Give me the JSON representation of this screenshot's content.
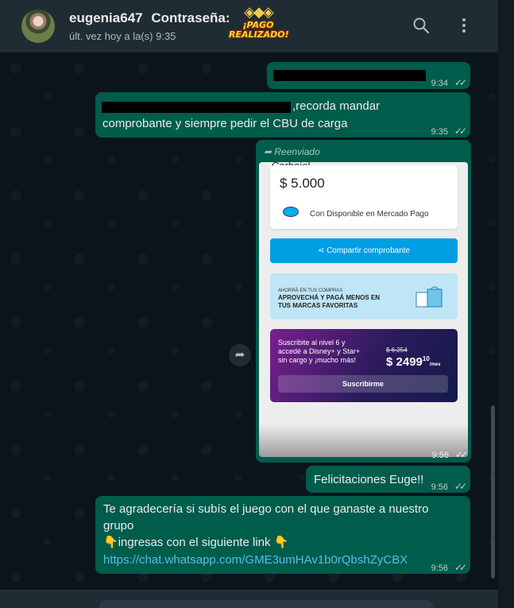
{
  "header": {
    "contact_name": "eugenia647",
    "contact_extra": "Contraseña:",
    "last_seen": "últ. vez hoy a la(s) 9:35",
    "sticker_line1": "¡PAGO",
    "sticker_line2": "REALIZADO!"
  },
  "messages": [
    {
      "time": "9:34",
      "ticks": "✓✓"
    },
    {
      "text_visible": ",recorda mandar",
      "text_line2": "comprobante y siempre pedir el CBU de carga",
      "time": "9:35",
      "ticks": "✓✓"
    },
    {
      "forwarded_label": "Reenviado",
      "time": "9:56",
      "ticks": "✓✓",
      "screenshot": {
        "partial_name": "Carbajal",
        "amount": "$ 5.000",
        "payment_method": "Con Disponible en Mercado Pago",
        "share_button": "Compartir comprobante",
        "promo_small": "AHORRÁ EN TUS COMPRAS",
        "promo_line1": "APROVECHÁ Y PAGÁ MENOS EN",
        "promo_line2": "TUS MARCAS FAVORITAS",
        "subscribe_line1": "Suscribite al nivel 6 y",
        "subscribe_line2": "accedé a Disney+ y Star+",
        "subscribe_line3": "sin cargo y ¡mucho más!",
        "old_price": "$ 6.254",
        "new_price": "$ 2499",
        "new_price_cents": "10",
        "per_month": "/mes",
        "subscribe_button": "Suscribirme"
      }
    },
    {
      "text": "Felicitaciones Euge!!",
      "time": "9:56",
      "ticks": "✓✓"
    },
    {
      "line1": "Te agradecería si subís el juego con el que ganaste a nuestro",
      "line2": "grupo",
      "line3_emoji": "👇",
      "line3": "ingresas con el siguiente link",
      "line3_emoji_end": "👇",
      "link": "https://chat.whatsapp.com/GME3umHAv1b0rQbshZyCBX",
      "time": "9:56",
      "ticks": "✓✓"
    }
  ],
  "icons": {
    "search": "search-icon",
    "menu": "kebab-menu-icon",
    "forward": "forward-icon",
    "emoji": "emoji-icon"
  },
  "colors": {
    "header": "#202c33",
    "outgoing_bubble": "#005c4b",
    "link": "#53bdeb",
    "mp_blue": "#009ee3"
  }
}
